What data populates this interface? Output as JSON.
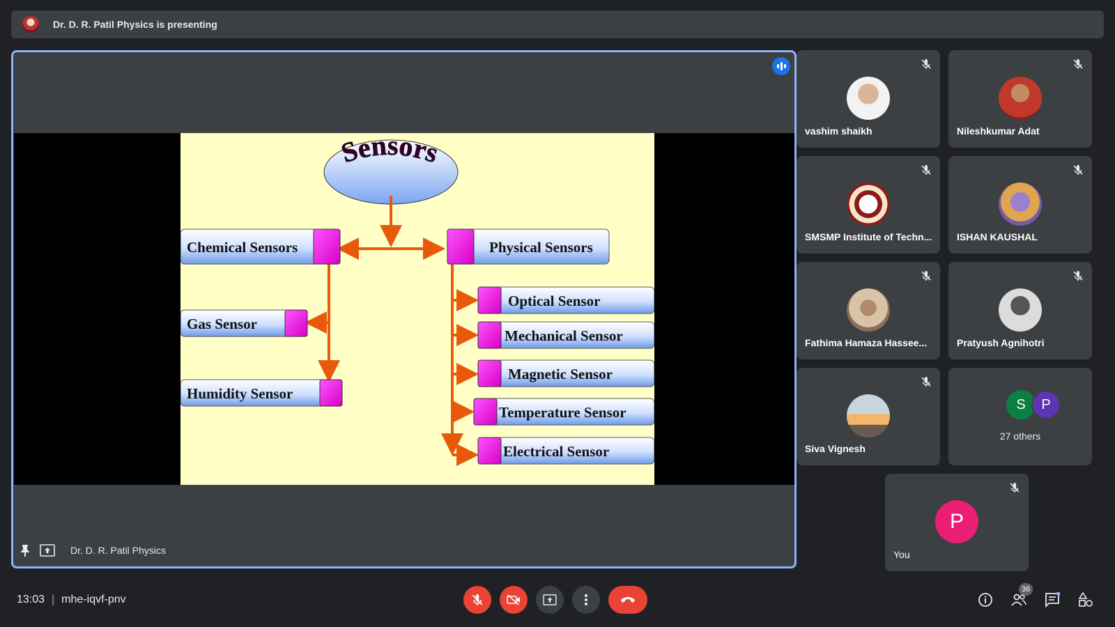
{
  "presenter_banner": {
    "text": "Dr. D. R. Patil Physics is presenting"
  },
  "stage": {
    "presenter_name": "Dr. D. R. Patil Physics",
    "slide": {
      "title": "Sensors",
      "left_main": "Chemical Sensors",
      "right_main": "Physical Sensors",
      "left_items": [
        "Gas Sensor",
        "Humidity Sensor"
      ],
      "right_items": [
        "Optical Sensor",
        "Mechanical Sensor",
        "Magnetic Sensor",
        "Temperature Sensor",
        "Electrical Sensor"
      ]
    }
  },
  "participants": [
    {
      "name": "vashim shaikh",
      "muted": true,
      "avatar": "photo"
    },
    {
      "name": "Nileshkumar Adat",
      "muted": true,
      "avatar": "photo"
    },
    {
      "name": "SMSMP Institute of Techn...",
      "muted": true,
      "avatar": "logo"
    },
    {
      "name": "ISHAN KAUSHAL",
      "muted": true,
      "avatar": "photo"
    },
    {
      "name": "Fathima Hamaza Hassee...",
      "muted": true,
      "avatar": "photo"
    },
    {
      "name": "Pratyush Agnihotri",
      "muted": true,
      "avatar": "photo"
    },
    {
      "name": "Siva Vignesh",
      "muted": true,
      "avatar": "photo"
    }
  ],
  "others_tile": {
    "initials": [
      "S",
      "P"
    ],
    "label": "27 others"
  },
  "self_tile": {
    "initial": "P",
    "label": "You"
  },
  "bottom_bar": {
    "time": "13:03",
    "meeting_code": "mhe-iqvf-pnv",
    "people_count": "36"
  },
  "colors": {
    "accent": "#8ab4f8",
    "danger": "#ea4335",
    "self_avatar": "#e91e74"
  }
}
